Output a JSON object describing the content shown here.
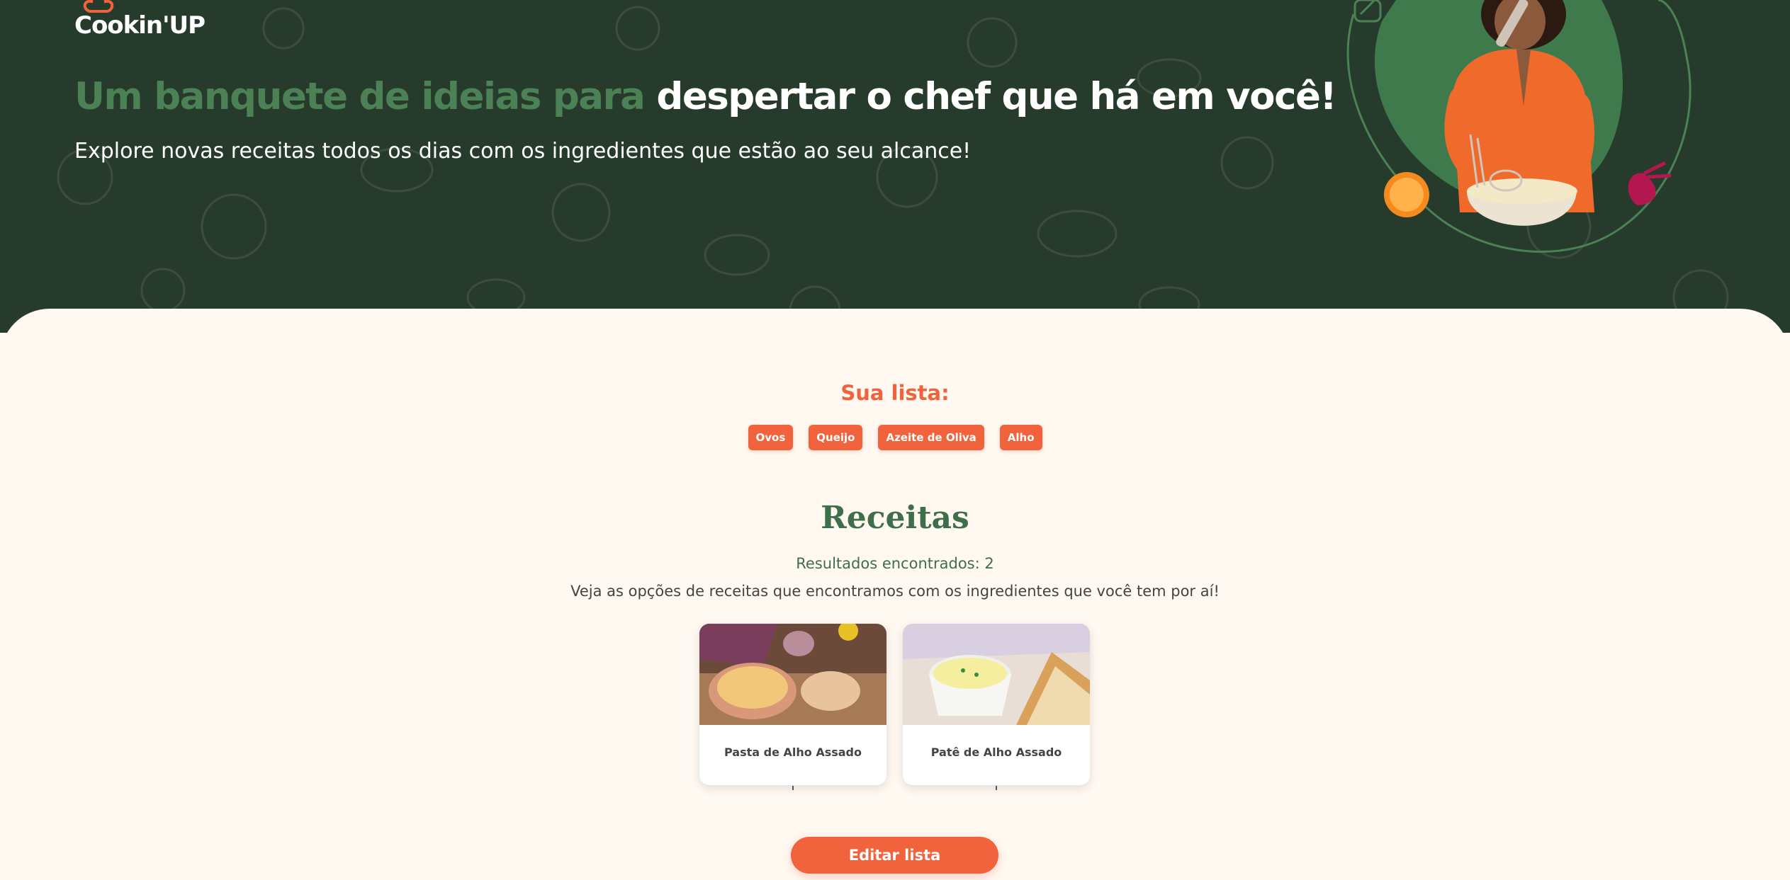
{
  "header": {
    "logo_text": "Cookin'UP",
    "headline_green": "Um banquete de ideias para ",
    "headline_white": "despertar o chef que há em você!",
    "subheadline": "Explore novas receitas todos os dias com os ingredientes que estão ao seu alcance!"
  },
  "list": {
    "title": "Sua lista:",
    "tags": [
      "Ovos",
      "Queijo",
      "Azeite de Oliva",
      "Alho"
    ]
  },
  "recipes": {
    "title": "Receitas",
    "results_text": "Resultados encontrados: 2",
    "description": "Veja as opções de receitas que encontramos com os ingredientes que você tem por aí!",
    "cards": [
      {
        "title": "Pasta de Alho Assado",
        "image": "garlic-paste-photo"
      },
      {
        "title": "Patê de Alho Assado",
        "image": "garlic-pate-photo"
      }
    ]
  },
  "actions": {
    "edit_label": "Editar lista"
  },
  "colors": {
    "hero_bg": "#273B2C",
    "accent_green": "#4C8155",
    "brand_orange": "#F0633C",
    "page_bg": "#FFF9F2"
  }
}
